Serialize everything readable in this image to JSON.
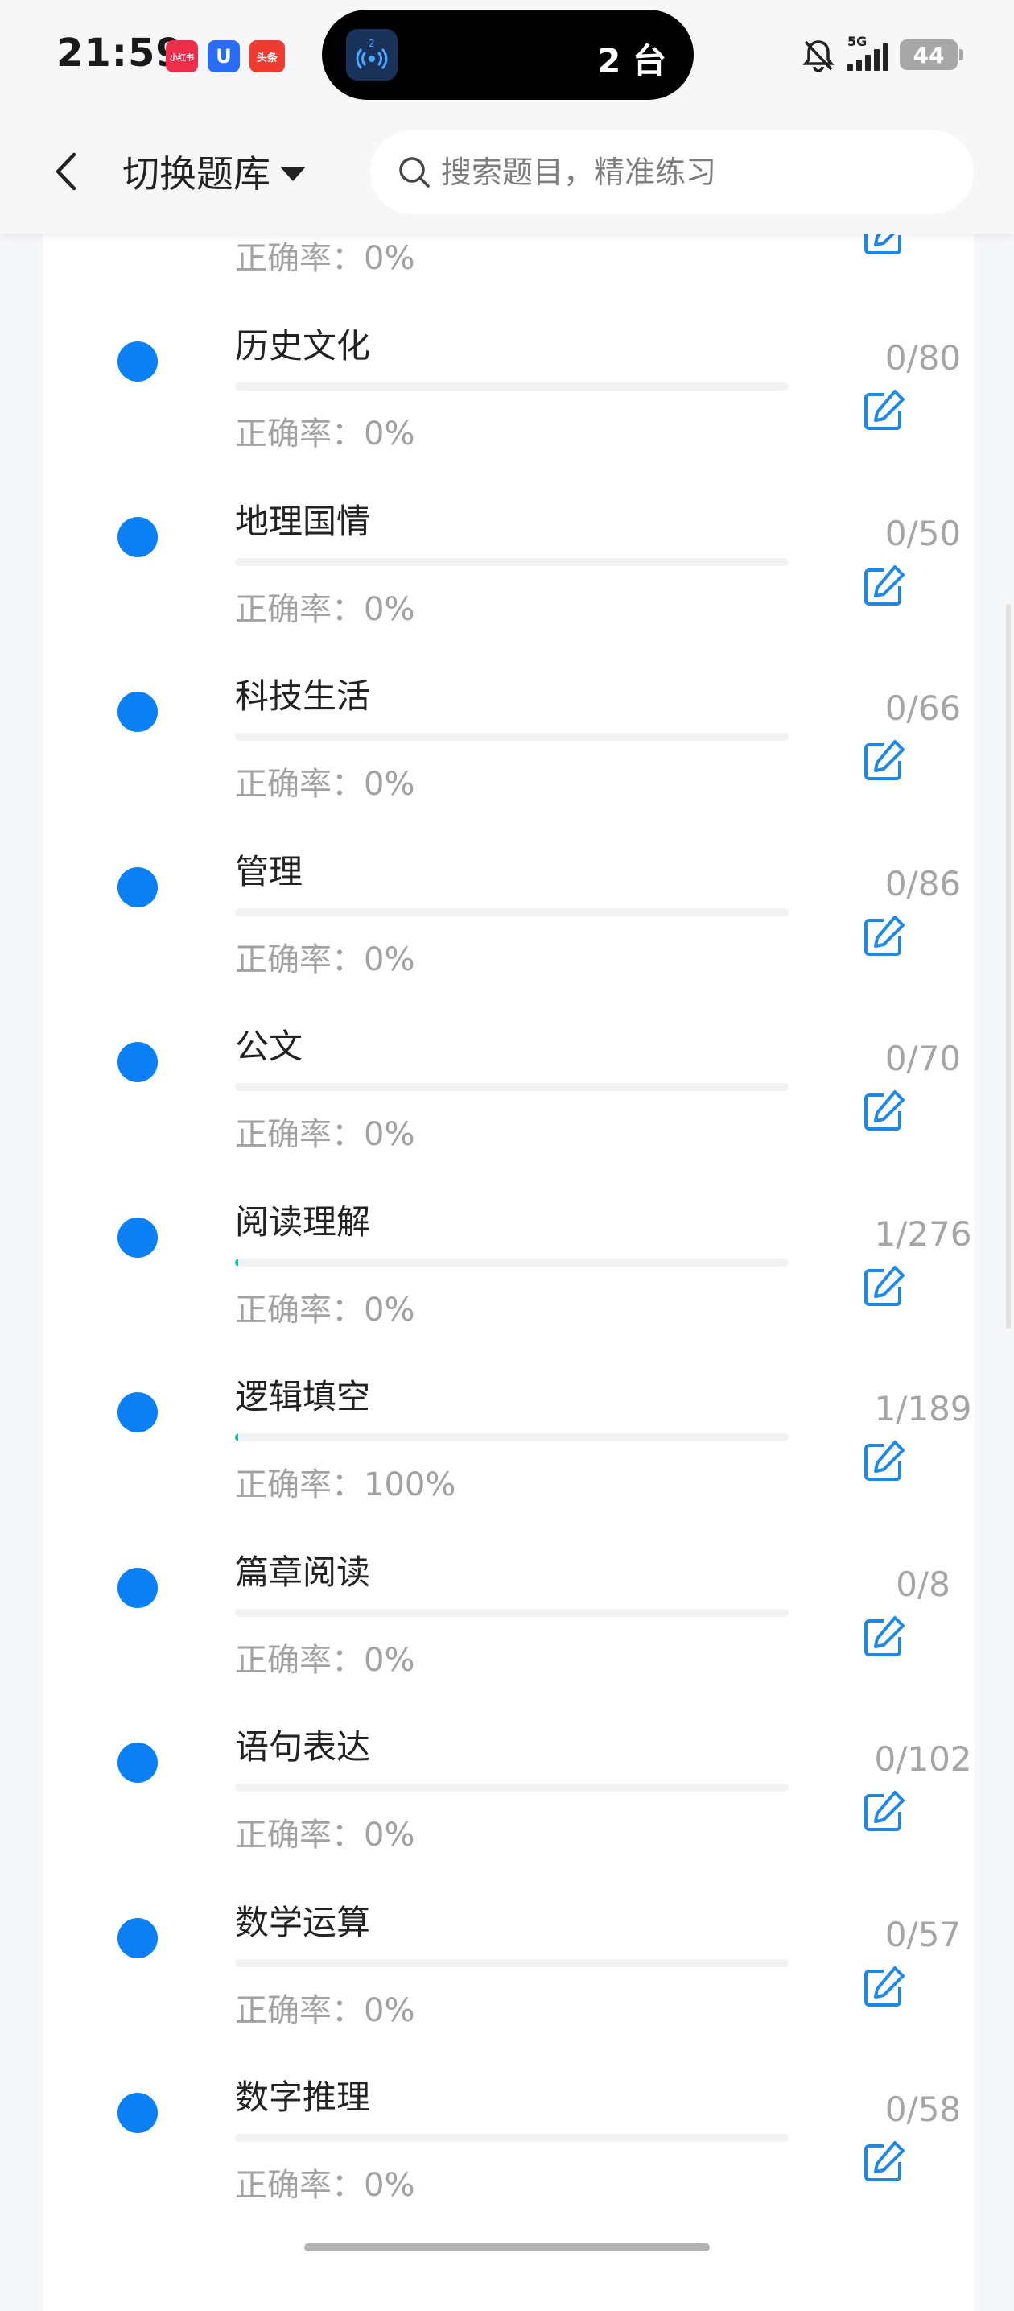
{
  "status": {
    "time": "21:59",
    "app_badges": [
      "小红书",
      "U",
      "头条"
    ],
    "island_count": "2 台",
    "island_badge": "2",
    "network": "5G",
    "battery": "44"
  },
  "header": {
    "title": "切换题库",
    "search_placeholder": "搜索题目，精准练习"
  },
  "partial_row": {
    "accuracy": "正确率：0%"
  },
  "items": [
    {
      "name": "历史文化",
      "count": "0/80",
      "accuracy": "正确率：0%",
      "progress": 0
    },
    {
      "name": "地理国情",
      "count": "0/50",
      "accuracy": "正确率：0%",
      "progress": 0
    },
    {
      "name": "科技生活",
      "count": "0/66",
      "accuracy": "正确率：0%",
      "progress": 0
    },
    {
      "name": "管理",
      "count": "0/86",
      "accuracy": "正确率：0%",
      "progress": 0
    },
    {
      "name": "公文",
      "count": "0/70",
      "accuracy": "正确率：0%",
      "progress": 0
    },
    {
      "name": "阅读理解",
      "count": "1/276",
      "accuracy": "正确率：0%",
      "progress": 0.0036
    },
    {
      "name": "逻辑填空",
      "count": "1/189",
      "accuracy": "正确率：100%",
      "progress": 0.0053
    },
    {
      "name": "篇章阅读",
      "count": "0/8",
      "accuracy": "正确率：0%",
      "progress": 0
    },
    {
      "name": "语句表达",
      "count": "0/102",
      "accuracy": "正确率：0%",
      "progress": 0
    },
    {
      "name": "数学运算",
      "count": "0/57",
      "accuracy": "正确率：0%",
      "progress": 0
    },
    {
      "name": "数字推理",
      "count": "0/58",
      "accuracy": "正确率：0%",
      "progress": 0
    }
  ],
  "colors": {
    "dot": "#0b7ff4",
    "progress": "#1abc9c",
    "edit_icon": "#1e88e5"
  },
  "icons": {
    "back": "chevron-left-icon",
    "caret": "caret-down-icon",
    "search": "search-icon",
    "edit": "edit-icon"
  }
}
